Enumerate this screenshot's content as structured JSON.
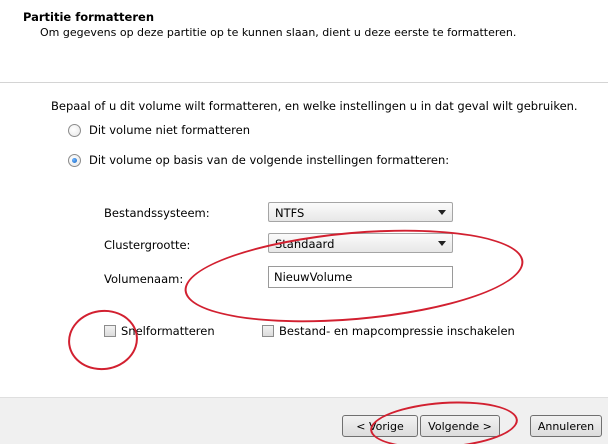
{
  "header": {
    "title": "Partitie formatteren",
    "subtitle": "Om gegevens op deze partitie op te kunnen slaan, dient u deze eerste te formatteren."
  },
  "body": {
    "prompt": "Bepaal of u dit volume wilt formatteren, en welke instellingen u in dat geval wilt gebruiken.",
    "radio_no_format": "Dit volume niet formatteren",
    "radio_format": "Dit volume op basis van de volgende instellingen formatteren:",
    "radio_selected": "format",
    "filesystem_label": "Bestandssysteem:",
    "filesystem_value": "NTFS",
    "cluster_label": "Clustergrootte:",
    "cluster_value": "Standaard",
    "volume_label": "Volumenaam:",
    "volume_value": "NieuwVolume",
    "quick_format_label": "Snelformatteren",
    "quick_format_checked": false,
    "compression_label": "Bestand- en mapcompressie inschakelen",
    "compression_checked": false
  },
  "footer": {
    "back_label": "< Vorige",
    "next_label": "Volgende >",
    "cancel_label": "Annuleren"
  },
  "annotation_color": "#d22030"
}
